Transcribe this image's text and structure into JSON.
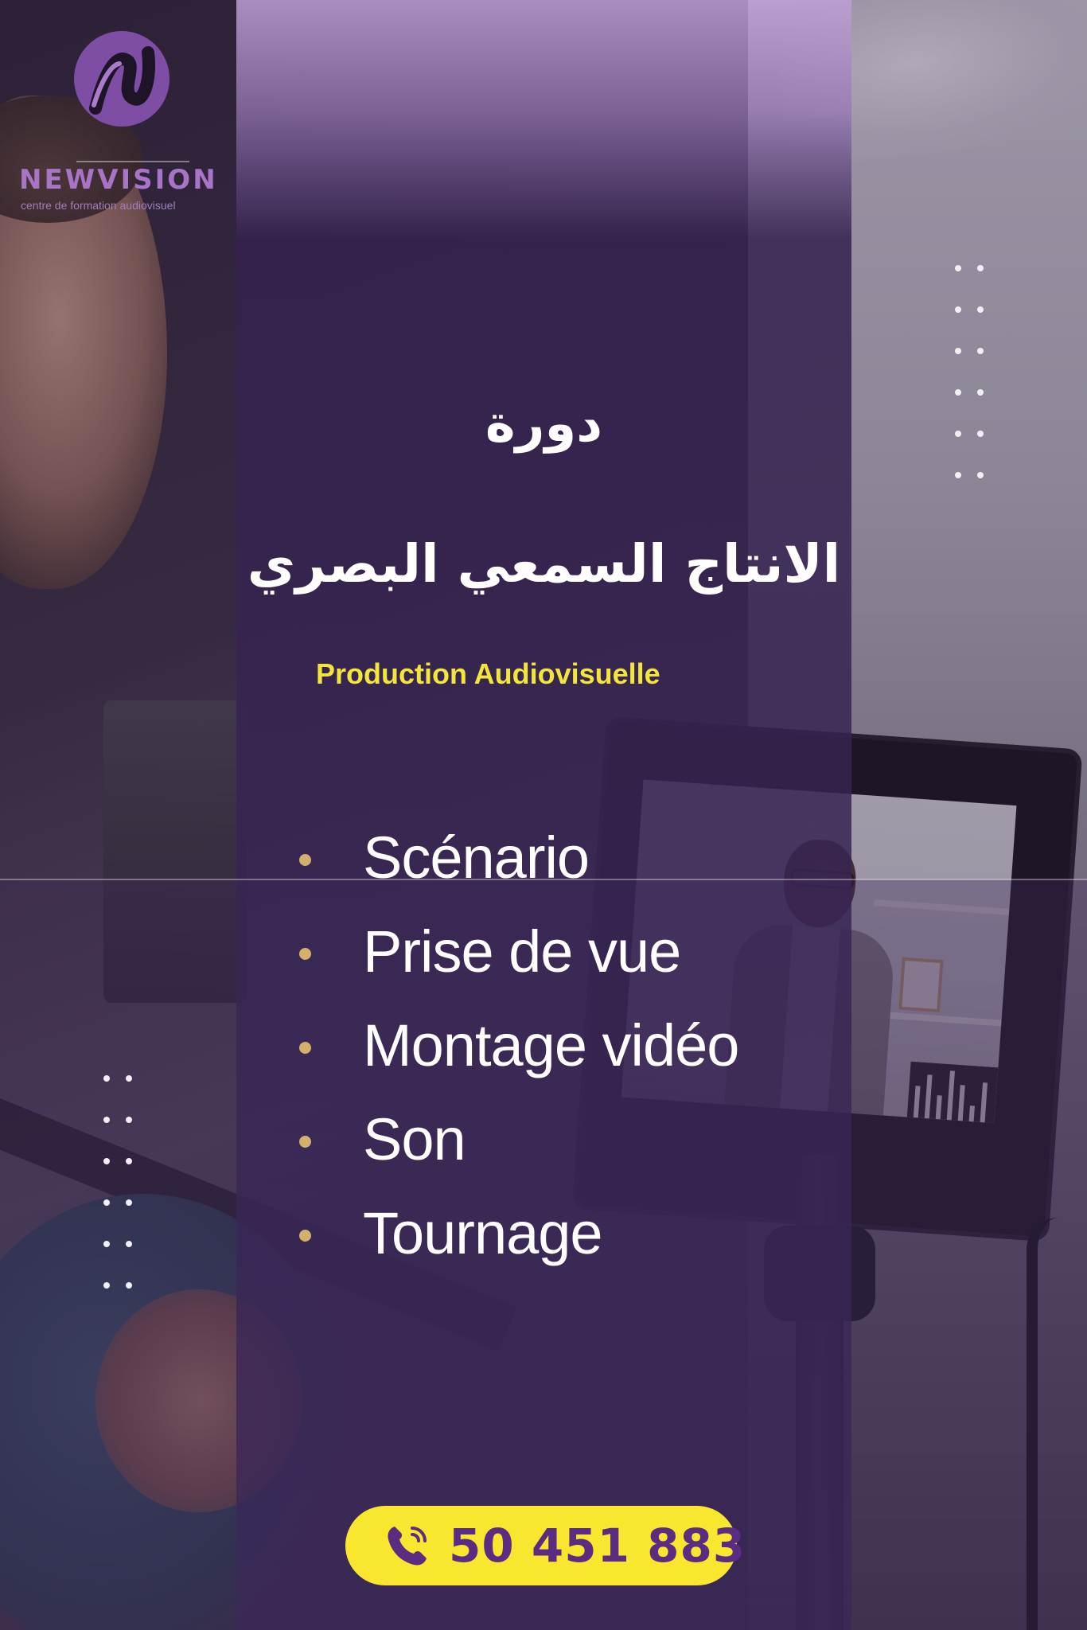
{
  "logo": {
    "name": "NEWVISION",
    "tagline": "centre de formation audiovisuel"
  },
  "title_ar_line1": "دورة",
  "title_ar_line2": "الانتاج السمعي البصري",
  "subtitle": "Production Audiovisuelle",
  "courses": [
    "Scénario",
    "Prise de vue",
    "Montage vidéo",
    "Son",
    "Tournage"
  ],
  "contact": {
    "phone": "50 451 883",
    "icon": "phone-icon"
  },
  "colors": {
    "overlay_purple": "#34224e",
    "accent_yellow": "#f9e62e",
    "phone_text": "#5b2d82",
    "bullet_gold": "#d2b06e",
    "logo_purple": "#a774c6"
  }
}
